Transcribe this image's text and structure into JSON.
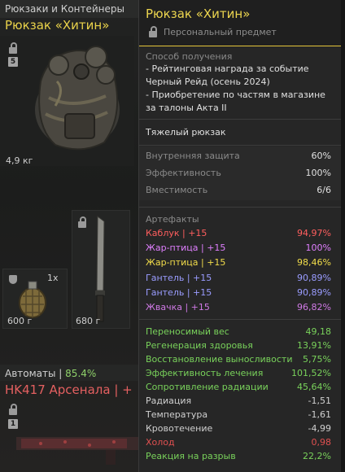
{
  "left": {
    "category": "Рюкзаки и Контейнеры",
    "item_name": "Рюкзак «Хитин»",
    "item_badge": "5",
    "item_weight": "4,9 кг",
    "grenade_qty": "1x",
    "grenade_weight": "600 г",
    "machete_weight": "680 г",
    "auto_label": "Автоматы |",
    "auto_pct": "85.4%",
    "gun_name": "HK417 Арсенала | +",
    "gun_badge": "1"
  },
  "tooltip": {
    "title": "Рюкзак «Хитин»",
    "subtitle": "Персональный предмет",
    "source_heading": "Способ получения",
    "source_lines": [
      "- Рейтинговая награда за событие",
      "Черный Рейд (осень 2024)",
      "- Приобретение по частям в магазине",
      "за талоны Акта II"
    ],
    "type": "Тяжелый рюкзак",
    "base_stats": [
      {
        "label": "Внутренняя защита",
        "value": "60%"
      },
      {
        "label": "Эффективность",
        "value": "100%"
      },
      {
        "label": "Вместимость",
        "value": "6/6"
      }
    ],
    "artifacts_heading": "Артефакты",
    "artifacts": [
      {
        "label": "Каблук | +15",
        "value": "94,97%",
        "color": "#ff5e5e"
      },
      {
        "label": "Жар-птица | +15",
        "value": "100%",
        "color": "#e07fff"
      },
      {
        "label": "Жар-птица | +15",
        "value": "98,46%",
        "color": "#f2dd4a"
      },
      {
        "label": "Гантель | +15",
        "value": "90,89%",
        "color": "#9a9cff"
      },
      {
        "label": "Гантель | +15",
        "value": "90,89%",
        "color": "#9a9cff"
      },
      {
        "label": "Жвачка | +15",
        "value": "96,82%",
        "color": "#d07ae6"
      }
    ],
    "effects": [
      {
        "label": "Переносимый вес",
        "value": "49,18",
        "color": "#79d25b"
      },
      {
        "label": "Регенерация здоровья",
        "value": "13,91%",
        "color": "#79d25b"
      },
      {
        "label": "Восстановление выносливости",
        "value": "5,75%",
        "color": "#79d25b"
      },
      {
        "label": "Эффективность лечения",
        "value": "101,52%",
        "color": "#79d25b"
      },
      {
        "label": "Сопротивление радиации",
        "value": "45,64%",
        "color": "#79d25b"
      },
      {
        "label": "Радиация",
        "value": "-1,51",
        "color": "#d0d0d0"
      },
      {
        "label": "Температура",
        "value": "-1,61",
        "color": "#d0d0d0"
      },
      {
        "label": "Кровотечение",
        "value": "-4,99",
        "color": "#d0d0d0"
      },
      {
        "label": "Холод",
        "value": "0,98",
        "color": "#e05050"
      },
      {
        "label": "Реакция на разрыв",
        "value": "22,2%",
        "color": "#79d25b"
      }
    ]
  },
  "colors": {
    "accent": "#e9d24a",
    "bad": "#e05050",
    "good": "#79d25b"
  }
}
